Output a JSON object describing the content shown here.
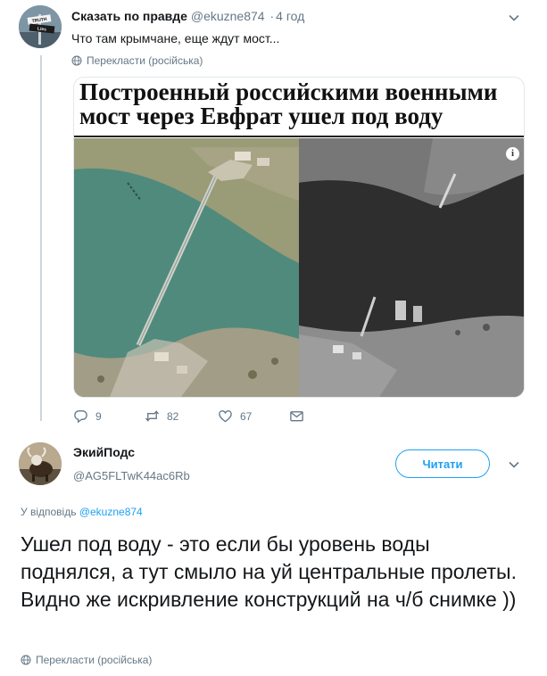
{
  "tweet1": {
    "author_name": "Сказать по правде",
    "handle": "@ekuzne874",
    "separator": "·",
    "time": "4 год",
    "text": "Что там крымчане, еще ждут мост...",
    "translate_label": "Перекласти (російська)",
    "avatar_text_top": "TRUTH",
    "avatar_text_sign": "Lies",
    "media": {
      "headline_line1": "Построенный российскими военными",
      "headline_line2": "мост через Евфрат ушел под воду",
      "info_glyph": "i"
    },
    "actions": {
      "reply_count": "9",
      "retweet_count": "82",
      "like_count": "67"
    }
  },
  "tweet2": {
    "author_name": "ЭкийПодс",
    "handle": "@AG5FLTwK44ac6Rb",
    "follow_label": "Читати",
    "reply_prefix": "У відповідь",
    "reply_handle": "@ekuzne874",
    "text": "Ушел под воду - это если бы уровень воды поднялся, а тут смыло на  уй центральные пролеты. Видно же искривление конструкций на ч/б снимке ))",
    "translate_label": "Перекласти (російська)"
  },
  "icons": {
    "globe": "globe-icon",
    "chevron": "chevron-down-icon",
    "reply": "reply-icon",
    "retweet": "retweet-icon",
    "like": "heart-icon",
    "dm": "envelope-icon"
  },
  "colors": {
    "accent": "#1da1f2",
    "muted": "#657786",
    "text": "#14171a",
    "thread_line": "#ccd6dd"
  }
}
